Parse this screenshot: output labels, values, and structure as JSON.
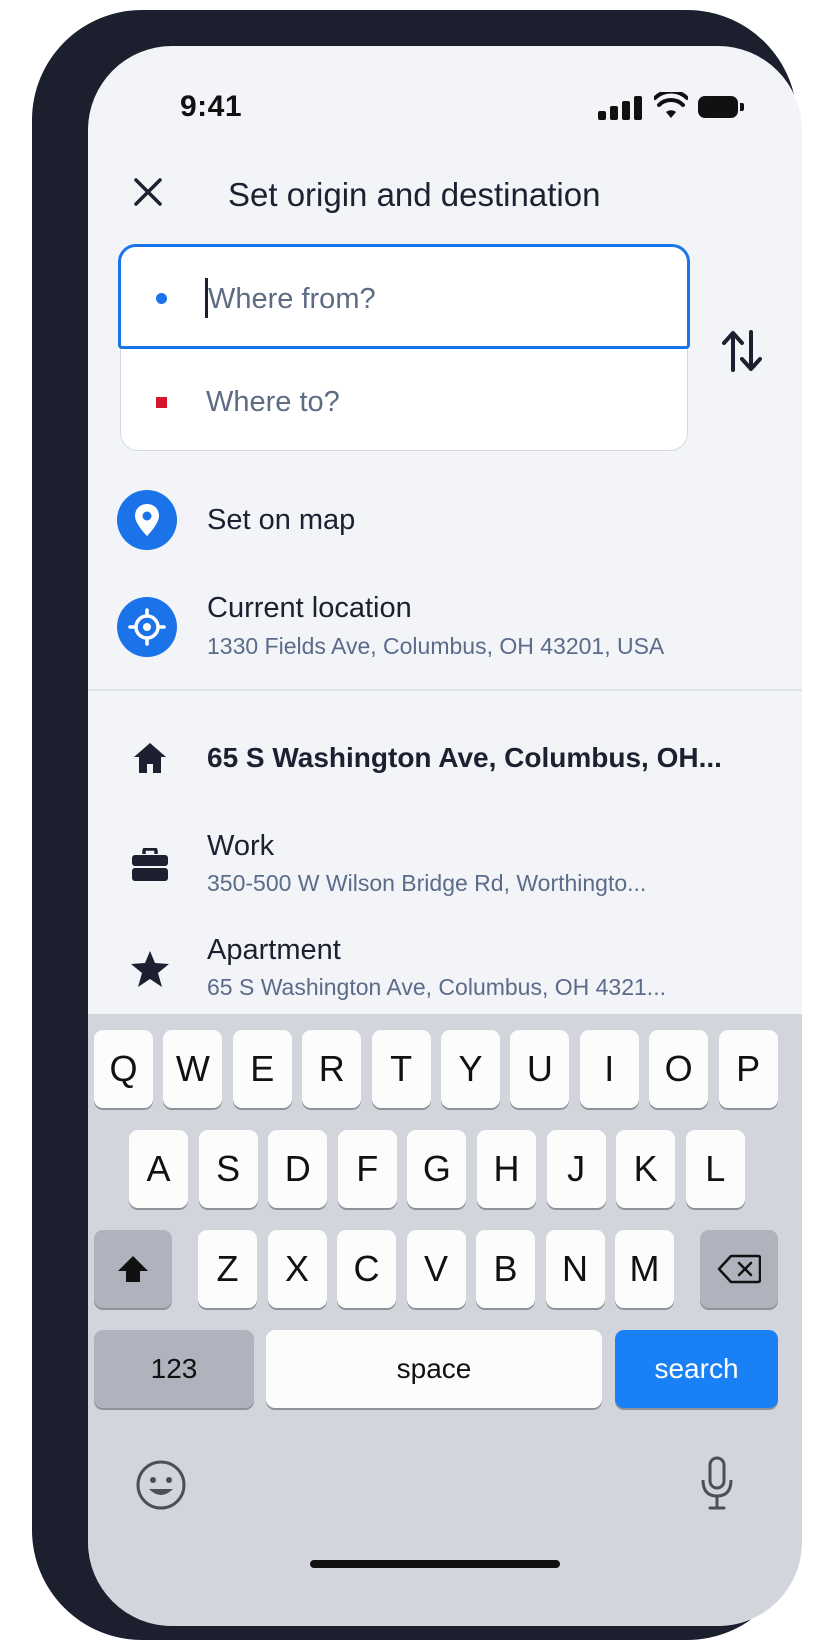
{
  "status_bar": {
    "time": "9:41"
  },
  "header": {
    "title": "Set origin and destination"
  },
  "inputs": {
    "from_placeholder": "Where from?",
    "to_placeholder": "Where to?",
    "from_dot_color": "#1a73e8",
    "to_dot_color": "#d3162d"
  },
  "quick_actions": [
    {
      "label": "Set on map",
      "icon": "map-pin-icon"
    },
    {
      "label": "Current location",
      "sublabel": "1330 Fields Ave, Columbus, OH 43201, USA",
      "icon": "crosshair-icon"
    }
  ],
  "saved_places": [
    {
      "label": "65 S Washington Ave, Columbus, OH...",
      "icon": "home-icon"
    },
    {
      "label": "Work",
      "sublabel": "350-500 W Wilson Bridge Rd, Worthingto...",
      "icon": "briefcase-icon"
    },
    {
      "label": "Apartment",
      "sublabel": "65 S Washington Ave, Columbus, OH 4321...",
      "icon": "star-icon"
    }
  ],
  "keyboard": {
    "row1": [
      "Q",
      "W",
      "E",
      "R",
      "T",
      "Y",
      "U",
      "I",
      "O",
      "P"
    ],
    "row2": [
      "A",
      "S",
      "D",
      "F",
      "G",
      "H",
      "J",
      "K",
      "L"
    ],
    "row3": [
      "Z",
      "X",
      "C",
      "V",
      "B",
      "N",
      "M"
    ],
    "numbers_label": "123",
    "space_label": "space",
    "search_label": "search",
    "accent_color": "#1a80f5"
  }
}
